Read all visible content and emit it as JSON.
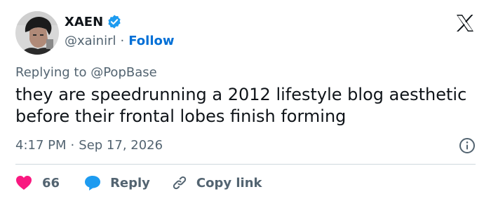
{
  "author": {
    "display_name": "XAEN",
    "handle": "@xainirl",
    "separator": "·",
    "follow_label": "Follow",
    "verified_color": "#1d9bf0"
  },
  "tweet": {
    "replying_prefix": "Replying to",
    "replying_to": "@PopBase",
    "text": "they are speedrunning a 2012 lifestyle blog aesthetic before their frontal lobes finish forming",
    "time": "4:17 PM",
    "separator": "·",
    "date": "Sep 17, 2026"
  },
  "actions": {
    "like_count": "66",
    "reply_label": "Reply",
    "copy_label": "Copy link"
  },
  "colors": {
    "like": "#f91880",
    "reply": "#1d9bf0",
    "link": "#006fd6",
    "muted": "#536471",
    "text": "#0f1419"
  },
  "icons": [
    "verified-badge-icon",
    "x-logo-icon",
    "info-icon",
    "heart-icon",
    "reply-bubble-icon",
    "link-icon"
  ]
}
